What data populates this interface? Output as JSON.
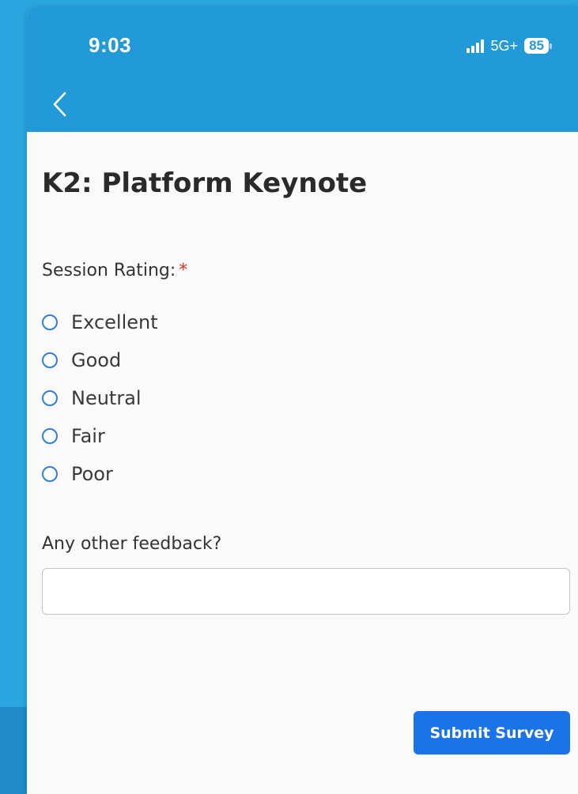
{
  "status_bar": {
    "time": "9:03",
    "network": "5G+",
    "battery": "85"
  },
  "nav": {
    "back_icon": "chevron-left-icon"
  },
  "page": {
    "title": "K2: Platform Keynote"
  },
  "rating": {
    "label": "Session Rating:",
    "required_mark": "*",
    "options": [
      "Excellent",
      "Good",
      "Neutral",
      "Fair",
      "Poor"
    ],
    "selected": null
  },
  "feedback": {
    "label": "Any other feedback?",
    "value": "",
    "placeholder": ""
  },
  "actions": {
    "submit_label": "Submit Survey"
  },
  "colors": {
    "header": "#229ad8",
    "background": "#2aa5df",
    "primary_button": "#1a73e8",
    "required": "#d9342b",
    "radio": "#2d7fd6"
  }
}
